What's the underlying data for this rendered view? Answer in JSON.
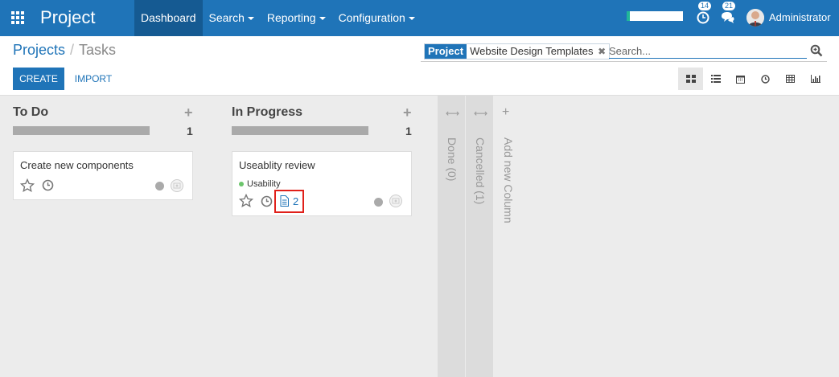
{
  "app": {
    "title": "Project"
  },
  "nav": {
    "items": [
      {
        "label": "Dashboard",
        "active": true
      },
      {
        "label": "Search"
      },
      {
        "label": "Reporting"
      },
      {
        "label": "Configuration"
      }
    ]
  },
  "systray": {
    "progress": 0.05,
    "activity_count": "14",
    "message_count": "21",
    "user": "Administrator"
  },
  "breadcrumb": {
    "parent": "Projects",
    "separator": "/",
    "current": "Tasks"
  },
  "search": {
    "facet_label": "Project",
    "facet_value": "Website Design Templates",
    "facet_remove": "✖",
    "placeholder": "Search..."
  },
  "buttons": {
    "create": "CREATE",
    "import": "IMPORT"
  },
  "views": [
    "kanban",
    "list",
    "calendar",
    "activity",
    "pivot",
    "graph"
  ],
  "columns": [
    {
      "title": "To Do",
      "count": "1",
      "cards": [
        {
          "title": "Create new components"
        }
      ]
    },
    {
      "title": "In Progress",
      "count": "1",
      "cards": [
        {
          "title": "Useablity review",
          "tag": "Usability",
          "attachments": "2"
        }
      ]
    }
  ],
  "folded_columns": [
    {
      "label": "Done (0)"
    },
    {
      "label": "Cancelled (1)"
    }
  ],
  "add_column": {
    "label": "Add new Column"
  },
  "colors": {
    "primary": "#1f74b8",
    "highlight": "#e0201a",
    "tag": "#6cc56c"
  }
}
